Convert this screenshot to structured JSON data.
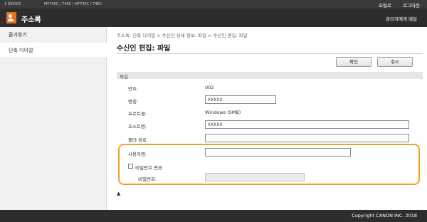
{
  "topbar": {
    "device_items": [
      "1 DEVICE",
      "MF745C / 746C  /  MF745C / 746C"
    ],
    "portal_label": "포털로",
    "logout_label": "로그아웃"
  },
  "header": {
    "title": "주소록",
    "admin_label": "관리자에게 메일"
  },
  "sidebar": {
    "items": [
      {
        "label": "즐겨찾기"
      },
      {
        "label": "단축 다이얼"
      }
    ]
  },
  "main": {
    "breadcrumb": "주소록: 단축 다이얼 > 수신인 상세 정보: 파일 > 수신인 편집: 파일",
    "title": "수신인 편집: 파일",
    "ok_label": "확인",
    "cancel_label": "취소",
    "section_title": "파일"
  },
  "form": {
    "number_label": "번호:",
    "number_value": "002",
    "name_label": "명칭:",
    "name_value": "XXXXX",
    "protocol_label": "프로토콜:",
    "protocol_value": "Windows (SMB)",
    "host_label": "호스트명:",
    "host_value": "XXXXX",
    "folder_label": "폴더 경로:",
    "folder_value": "",
    "username_label": "사용자명:",
    "username_value": "",
    "change_password_label": "비밀번호 변경",
    "change_password_checked": false,
    "password_label": "비밀번호:",
    "password_value": ""
  },
  "footer": {
    "copyright": "Copyright CANON INC. 2018"
  },
  "colors": {
    "accent": "#e8731e",
    "highlight": "#f0a41e",
    "header_bg": "#2d2d2d",
    "topbar_bg": "#3a3a3a"
  },
  "icons": [
    "address-book-icon",
    "scroll-to-top-icon"
  ]
}
